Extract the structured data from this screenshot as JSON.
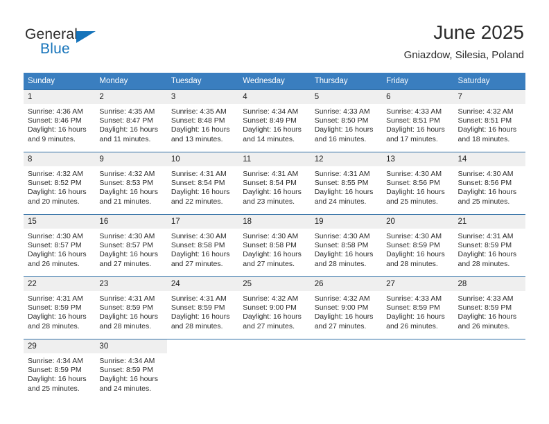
{
  "brand": {
    "name_part1": "General",
    "name_part2": "Blue",
    "logo_icon": "triangle-flag-icon",
    "accent_color": "#1573ba"
  },
  "header": {
    "title": "June 2025",
    "location": "Gniazdow, Silesia, Poland"
  },
  "calendar": {
    "header_bg": "#3a7ebf",
    "row_divider_color": "#2e6da4",
    "day_number_bg": "#efefef",
    "weekday_headers": [
      "Sunday",
      "Monday",
      "Tuesday",
      "Wednesday",
      "Thursday",
      "Friday",
      "Saturday"
    ],
    "weeks": [
      [
        {
          "day": "1",
          "sunrise": "Sunrise: 4:36 AM",
          "sunset": "Sunset: 8:46 PM",
          "daylight": "Daylight: 16 hours and 9 minutes."
        },
        {
          "day": "2",
          "sunrise": "Sunrise: 4:35 AM",
          "sunset": "Sunset: 8:47 PM",
          "daylight": "Daylight: 16 hours and 11 minutes."
        },
        {
          "day": "3",
          "sunrise": "Sunrise: 4:35 AM",
          "sunset": "Sunset: 8:48 PM",
          "daylight": "Daylight: 16 hours and 13 minutes."
        },
        {
          "day": "4",
          "sunrise": "Sunrise: 4:34 AM",
          "sunset": "Sunset: 8:49 PM",
          "daylight": "Daylight: 16 hours and 14 minutes."
        },
        {
          "day": "5",
          "sunrise": "Sunrise: 4:33 AM",
          "sunset": "Sunset: 8:50 PM",
          "daylight": "Daylight: 16 hours and 16 minutes."
        },
        {
          "day": "6",
          "sunrise": "Sunrise: 4:33 AM",
          "sunset": "Sunset: 8:51 PM",
          "daylight": "Daylight: 16 hours and 17 minutes."
        },
        {
          "day": "7",
          "sunrise": "Sunrise: 4:32 AM",
          "sunset": "Sunset: 8:51 PM",
          "daylight": "Daylight: 16 hours and 18 minutes."
        }
      ],
      [
        {
          "day": "8",
          "sunrise": "Sunrise: 4:32 AM",
          "sunset": "Sunset: 8:52 PM",
          "daylight": "Daylight: 16 hours and 20 minutes."
        },
        {
          "day": "9",
          "sunrise": "Sunrise: 4:32 AM",
          "sunset": "Sunset: 8:53 PM",
          "daylight": "Daylight: 16 hours and 21 minutes."
        },
        {
          "day": "10",
          "sunrise": "Sunrise: 4:31 AM",
          "sunset": "Sunset: 8:54 PM",
          "daylight": "Daylight: 16 hours and 22 minutes."
        },
        {
          "day": "11",
          "sunrise": "Sunrise: 4:31 AM",
          "sunset": "Sunset: 8:54 PM",
          "daylight": "Daylight: 16 hours and 23 minutes."
        },
        {
          "day": "12",
          "sunrise": "Sunrise: 4:31 AM",
          "sunset": "Sunset: 8:55 PM",
          "daylight": "Daylight: 16 hours and 24 minutes."
        },
        {
          "day": "13",
          "sunrise": "Sunrise: 4:30 AM",
          "sunset": "Sunset: 8:56 PM",
          "daylight": "Daylight: 16 hours and 25 minutes."
        },
        {
          "day": "14",
          "sunrise": "Sunrise: 4:30 AM",
          "sunset": "Sunset: 8:56 PM",
          "daylight": "Daylight: 16 hours and 25 minutes."
        }
      ],
      [
        {
          "day": "15",
          "sunrise": "Sunrise: 4:30 AM",
          "sunset": "Sunset: 8:57 PM",
          "daylight": "Daylight: 16 hours and 26 minutes."
        },
        {
          "day": "16",
          "sunrise": "Sunrise: 4:30 AM",
          "sunset": "Sunset: 8:57 PM",
          "daylight": "Daylight: 16 hours and 27 minutes."
        },
        {
          "day": "17",
          "sunrise": "Sunrise: 4:30 AM",
          "sunset": "Sunset: 8:58 PM",
          "daylight": "Daylight: 16 hours and 27 minutes."
        },
        {
          "day": "18",
          "sunrise": "Sunrise: 4:30 AM",
          "sunset": "Sunset: 8:58 PM",
          "daylight": "Daylight: 16 hours and 27 minutes."
        },
        {
          "day": "19",
          "sunrise": "Sunrise: 4:30 AM",
          "sunset": "Sunset: 8:58 PM",
          "daylight": "Daylight: 16 hours and 28 minutes."
        },
        {
          "day": "20",
          "sunrise": "Sunrise: 4:30 AM",
          "sunset": "Sunset: 8:59 PM",
          "daylight": "Daylight: 16 hours and 28 minutes."
        },
        {
          "day": "21",
          "sunrise": "Sunrise: 4:31 AM",
          "sunset": "Sunset: 8:59 PM",
          "daylight": "Daylight: 16 hours and 28 minutes."
        }
      ],
      [
        {
          "day": "22",
          "sunrise": "Sunrise: 4:31 AM",
          "sunset": "Sunset: 8:59 PM",
          "daylight": "Daylight: 16 hours and 28 minutes."
        },
        {
          "day": "23",
          "sunrise": "Sunrise: 4:31 AM",
          "sunset": "Sunset: 8:59 PM",
          "daylight": "Daylight: 16 hours and 28 minutes."
        },
        {
          "day": "24",
          "sunrise": "Sunrise: 4:31 AM",
          "sunset": "Sunset: 8:59 PM",
          "daylight": "Daylight: 16 hours and 28 minutes."
        },
        {
          "day": "25",
          "sunrise": "Sunrise: 4:32 AM",
          "sunset": "Sunset: 9:00 PM",
          "daylight": "Daylight: 16 hours and 27 minutes."
        },
        {
          "day": "26",
          "sunrise": "Sunrise: 4:32 AM",
          "sunset": "Sunset: 9:00 PM",
          "daylight": "Daylight: 16 hours and 27 minutes."
        },
        {
          "day": "27",
          "sunrise": "Sunrise: 4:33 AM",
          "sunset": "Sunset: 8:59 PM",
          "daylight": "Daylight: 16 hours and 26 minutes."
        },
        {
          "day": "28",
          "sunrise": "Sunrise: 4:33 AM",
          "sunset": "Sunset: 8:59 PM",
          "daylight": "Daylight: 16 hours and 26 minutes."
        }
      ],
      [
        {
          "day": "29",
          "sunrise": "Sunrise: 4:34 AM",
          "sunset": "Sunset: 8:59 PM",
          "daylight": "Daylight: 16 hours and 25 minutes."
        },
        {
          "day": "30",
          "sunrise": "Sunrise: 4:34 AM",
          "sunset": "Sunset: 8:59 PM",
          "daylight": "Daylight: 16 hours and 24 minutes."
        },
        {
          "day": "",
          "sunrise": "",
          "sunset": "",
          "daylight": ""
        },
        {
          "day": "",
          "sunrise": "",
          "sunset": "",
          "daylight": ""
        },
        {
          "day": "",
          "sunrise": "",
          "sunset": "",
          "daylight": ""
        },
        {
          "day": "",
          "sunrise": "",
          "sunset": "",
          "daylight": ""
        },
        {
          "day": "",
          "sunrise": "",
          "sunset": "",
          "daylight": ""
        }
      ]
    ]
  }
}
